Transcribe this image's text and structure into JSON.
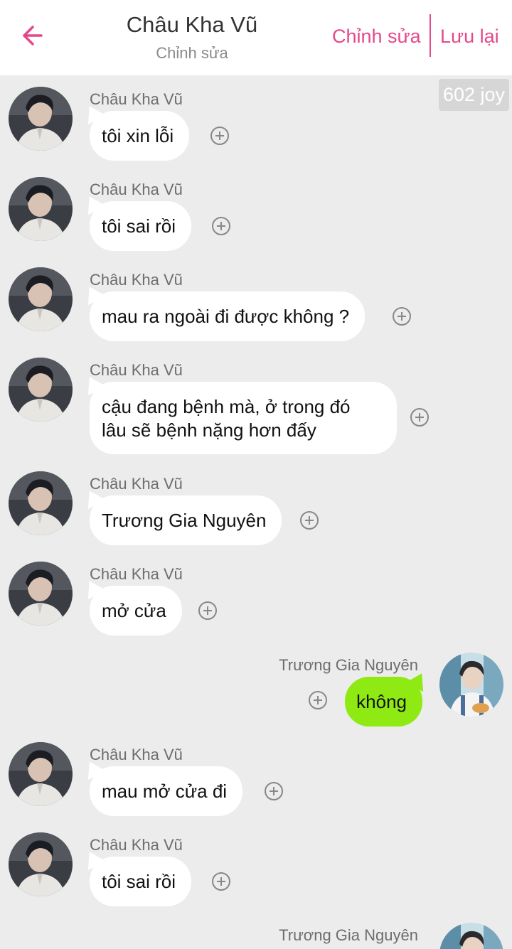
{
  "header": {
    "title": "Châu Kha Vũ",
    "subtitle": "Chỉnh sửa",
    "edit_label": "Chỉnh sửa",
    "save_label": "Lưu lại"
  },
  "joy_badge": "602 joy",
  "colors": {
    "accent": "#e5488a",
    "outgoing_bubble": "#8fea14",
    "incoming_bubble": "#ffffff",
    "background": "#ececec"
  },
  "messages": [
    {
      "sender": "Châu Kha Vũ",
      "text": "tôi xin lỗi",
      "side": "left"
    },
    {
      "sender": "Châu Kha Vũ",
      "text": "tôi sai rồi",
      "side": "left"
    },
    {
      "sender": "Châu Kha Vũ",
      "text": "mau ra ngoài đi được không ?",
      "side": "left"
    },
    {
      "sender": "Châu Kha Vũ",
      "text_line1": "cậu đang bệnh mà, ở trong đó",
      "text_line2": "lâu sẽ bệnh nặng hơn đấy",
      "side": "left"
    },
    {
      "sender": "Châu Kha Vũ",
      "text": "Trương Gia Nguyên",
      "side": "left"
    },
    {
      "sender": "Châu Kha Vũ",
      "text": "mở cửa",
      "side": "left"
    },
    {
      "sender": "Trương Gia Nguyên",
      "text": "không",
      "side": "right"
    },
    {
      "sender": "Châu Kha Vũ",
      "text": "mau mở cửa đi",
      "side": "left"
    },
    {
      "sender": "Châu Kha Vũ",
      "text": "tôi sai rồi",
      "side": "left"
    },
    {
      "sender": "Trương Gia Nguyên",
      "text": "",
      "side": "right"
    }
  ]
}
